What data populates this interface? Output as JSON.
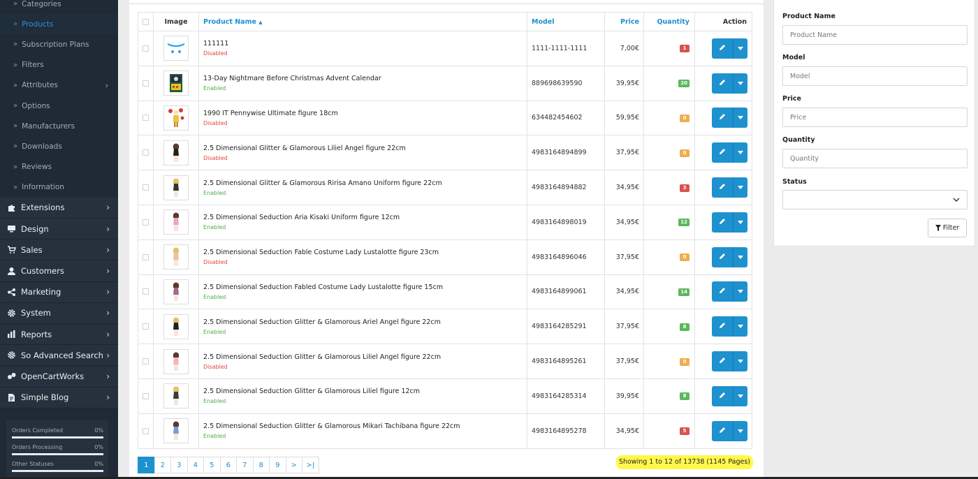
{
  "sidebar": {
    "sub_items": [
      {
        "label": "Categories",
        "active": false,
        "has_arrow": false
      },
      {
        "label": "Products",
        "active": true,
        "has_arrow": false
      },
      {
        "label": "Subscription Plans",
        "active": false,
        "has_arrow": false
      },
      {
        "label": "Filters",
        "active": false,
        "has_arrow": false
      },
      {
        "label": "Attributes",
        "active": false,
        "has_arrow": true
      },
      {
        "label": "Options",
        "active": false,
        "has_arrow": false
      },
      {
        "label": "Manufacturers",
        "active": false,
        "has_arrow": false
      },
      {
        "label": "Downloads",
        "active": false,
        "has_arrow": false
      },
      {
        "label": "Reviews",
        "active": false,
        "has_arrow": false
      },
      {
        "label": "Information",
        "active": false,
        "has_arrow": false
      }
    ],
    "main_items": [
      {
        "label": "Extensions",
        "icon": "puzzle-icon"
      },
      {
        "label": "Design",
        "icon": "monitor-icon"
      },
      {
        "label": "Sales",
        "icon": "cart-icon"
      },
      {
        "label": "Customers",
        "icon": "user-icon"
      },
      {
        "label": "Marketing",
        "icon": "share-icon"
      },
      {
        "label": "System",
        "icon": "gear-icon"
      },
      {
        "label": "Reports",
        "icon": "bar-chart-icon"
      },
      {
        "label": "So Advanced Search",
        "icon": "gear-icon"
      },
      {
        "label": "OpenCartWorks",
        "icon": "opencart-icon"
      },
      {
        "label": "Simple Blog",
        "icon": "document-icon"
      }
    ],
    "stats": [
      {
        "label": "Orders Completed",
        "value": "0%",
        "progress": 0
      },
      {
        "label": "Orders Processing",
        "value": "0%",
        "progress": 0
      },
      {
        "label": "Other Statuses",
        "value": "0%",
        "progress": 0
      }
    ]
  },
  "table": {
    "headers": {
      "image": "Image",
      "name": "Product Name",
      "model": "Model",
      "price": "Price",
      "quantity": "Quantity",
      "action": "Action"
    },
    "sort_indicator": "▲",
    "rows": [
      {
        "name": "111111",
        "status": "Disabled",
        "model": "1111-1111-1111",
        "price": "7,00€",
        "qty": "1",
        "badge": "#d9534f",
        "thumb": "opencart-cart-icon"
      },
      {
        "name": "13-Day Nightmare Before Christmas Advent Calendar",
        "status": "Enabled",
        "model": "889698639590",
        "price": "39,95€",
        "qty": "20",
        "badge": "#5cb85c",
        "thumb": "advent-box-icon"
      },
      {
        "name": "1990 IT Pennywise Ultimate figure 18cm",
        "status": "Disabled",
        "model": "634482454602",
        "price": "59,95€",
        "qty": "0",
        "badge": "#f0ad4e",
        "thumb": "clown-figure-icon"
      },
      {
        "name": "2.5 Dimensional Glitter & Glamorous Liliel Angel figure 22cm",
        "status": "Disabled",
        "model": "4983164894899",
        "price": "37,95€",
        "qty": "0",
        "badge": "#f0ad4e",
        "thumb": "figure-icon"
      },
      {
        "name": "2.5 Dimensional Glitter & Glamorous Ririsa Amano Uniform figure 22cm",
        "status": "Enabled",
        "model": "4983164894882",
        "price": "34,95€",
        "qty": "3",
        "badge": "#d9534f",
        "thumb": "figure-icon"
      },
      {
        "name": "2.5 Dimensional Seduction Aria Kisaki Uniform figure 12cm",
        "status": "Enabled",
        "model": "4983164898019",
        "price": "34,95€",
        "qty": "12",
        "badge": "#5cb85c",
        "thumb": "figure-icon"
      },
      {
        "name": "2.5 Dimensional Seduction Fable Costume Lady Lustalotte figure 23cm",
        "status": "Disabled",
        "model": "4983164896046",
        "price": "37,95€",
        "qty": "0",
        "badge": "#f0ad4e",
        "thumb": "figure-icon"
      },
      {
        "name": "2.5 Dimensional Seduction Fabled Costume Lady Lustalotte figure 15cm",
        "status": "Enabled",
        "model": "4983164899061",
        "price": "34,95€",
        "qty": "14",
        "badge": "#5cb85c",
        "thumb": "figure-icon"
      },
      {
        "name": "2.5 Dimensional Seduction Glitter & Glamorous Ariel Angel figure 22cm",
        "status": "Enabled",
        "model": "4983164285291",
        "price": "37,95€",
        "qty": "8",
        "badge": "#5cb85c",
        "thumb": "figure-icon"
      },
      {
        "name": "2.5 Dimensional Seduction Glitter & Glamorous Liliel Angel figure 22cm",
        "status": "Disabled",
        "model": "4983164895261",
        "price": "37,95€",
        "qty": "0",
        "badge": "#f0ad4e",
        "thumb": "figure-icon"
      },
      {
        "name": "2.5 Dimensional Seduction Glitter & Glamorous Liliel figure 12cm",
        "status": "Enabled",
        "model": "4983164285314",
        "price": "39,95€",
        "qty": "8",
        "badge": "#5cb85c",
        "thumb": "figure-icon"
      },
      {
        "name": "2.5 Dimensional Seduction Glitter & Glamorous Mikari Tachibana figure 22cm",
        "status": "Enabled",
        "model": "4983164895278",
        "price": "34,95€",
        "qty": "5",
        "badge": "#d9534f",
        "thumb": "figure-icon"
      }
    ]
  },
  "pagination": {
    "pages": [
      "1",
      "2",
      "3",
      "4",
      "5",
      "6",
      "7",
      "8",
      "9",
      ">",
      ">|"
    ],
    "active": "1",
    "showing_text": "Showing 1 to 12 of 13738 (1145 Pages)"
  },
  "filter": {
    "fields": [
      {
        "label": "Product Name",
        "placeholder": "Product Name"
      },
      {
        "label": "Model",
        "placeholder": "Model"
      },
      {
        "label": "Price",
        "placeholder": "Price"
      },
      {
        "label": "Quantity",
        "placeholder": "Quantity"
      }
    ],
    "status_label": "Status",
    "status_value": "",
    "button_label": "Filter"
  }
}
